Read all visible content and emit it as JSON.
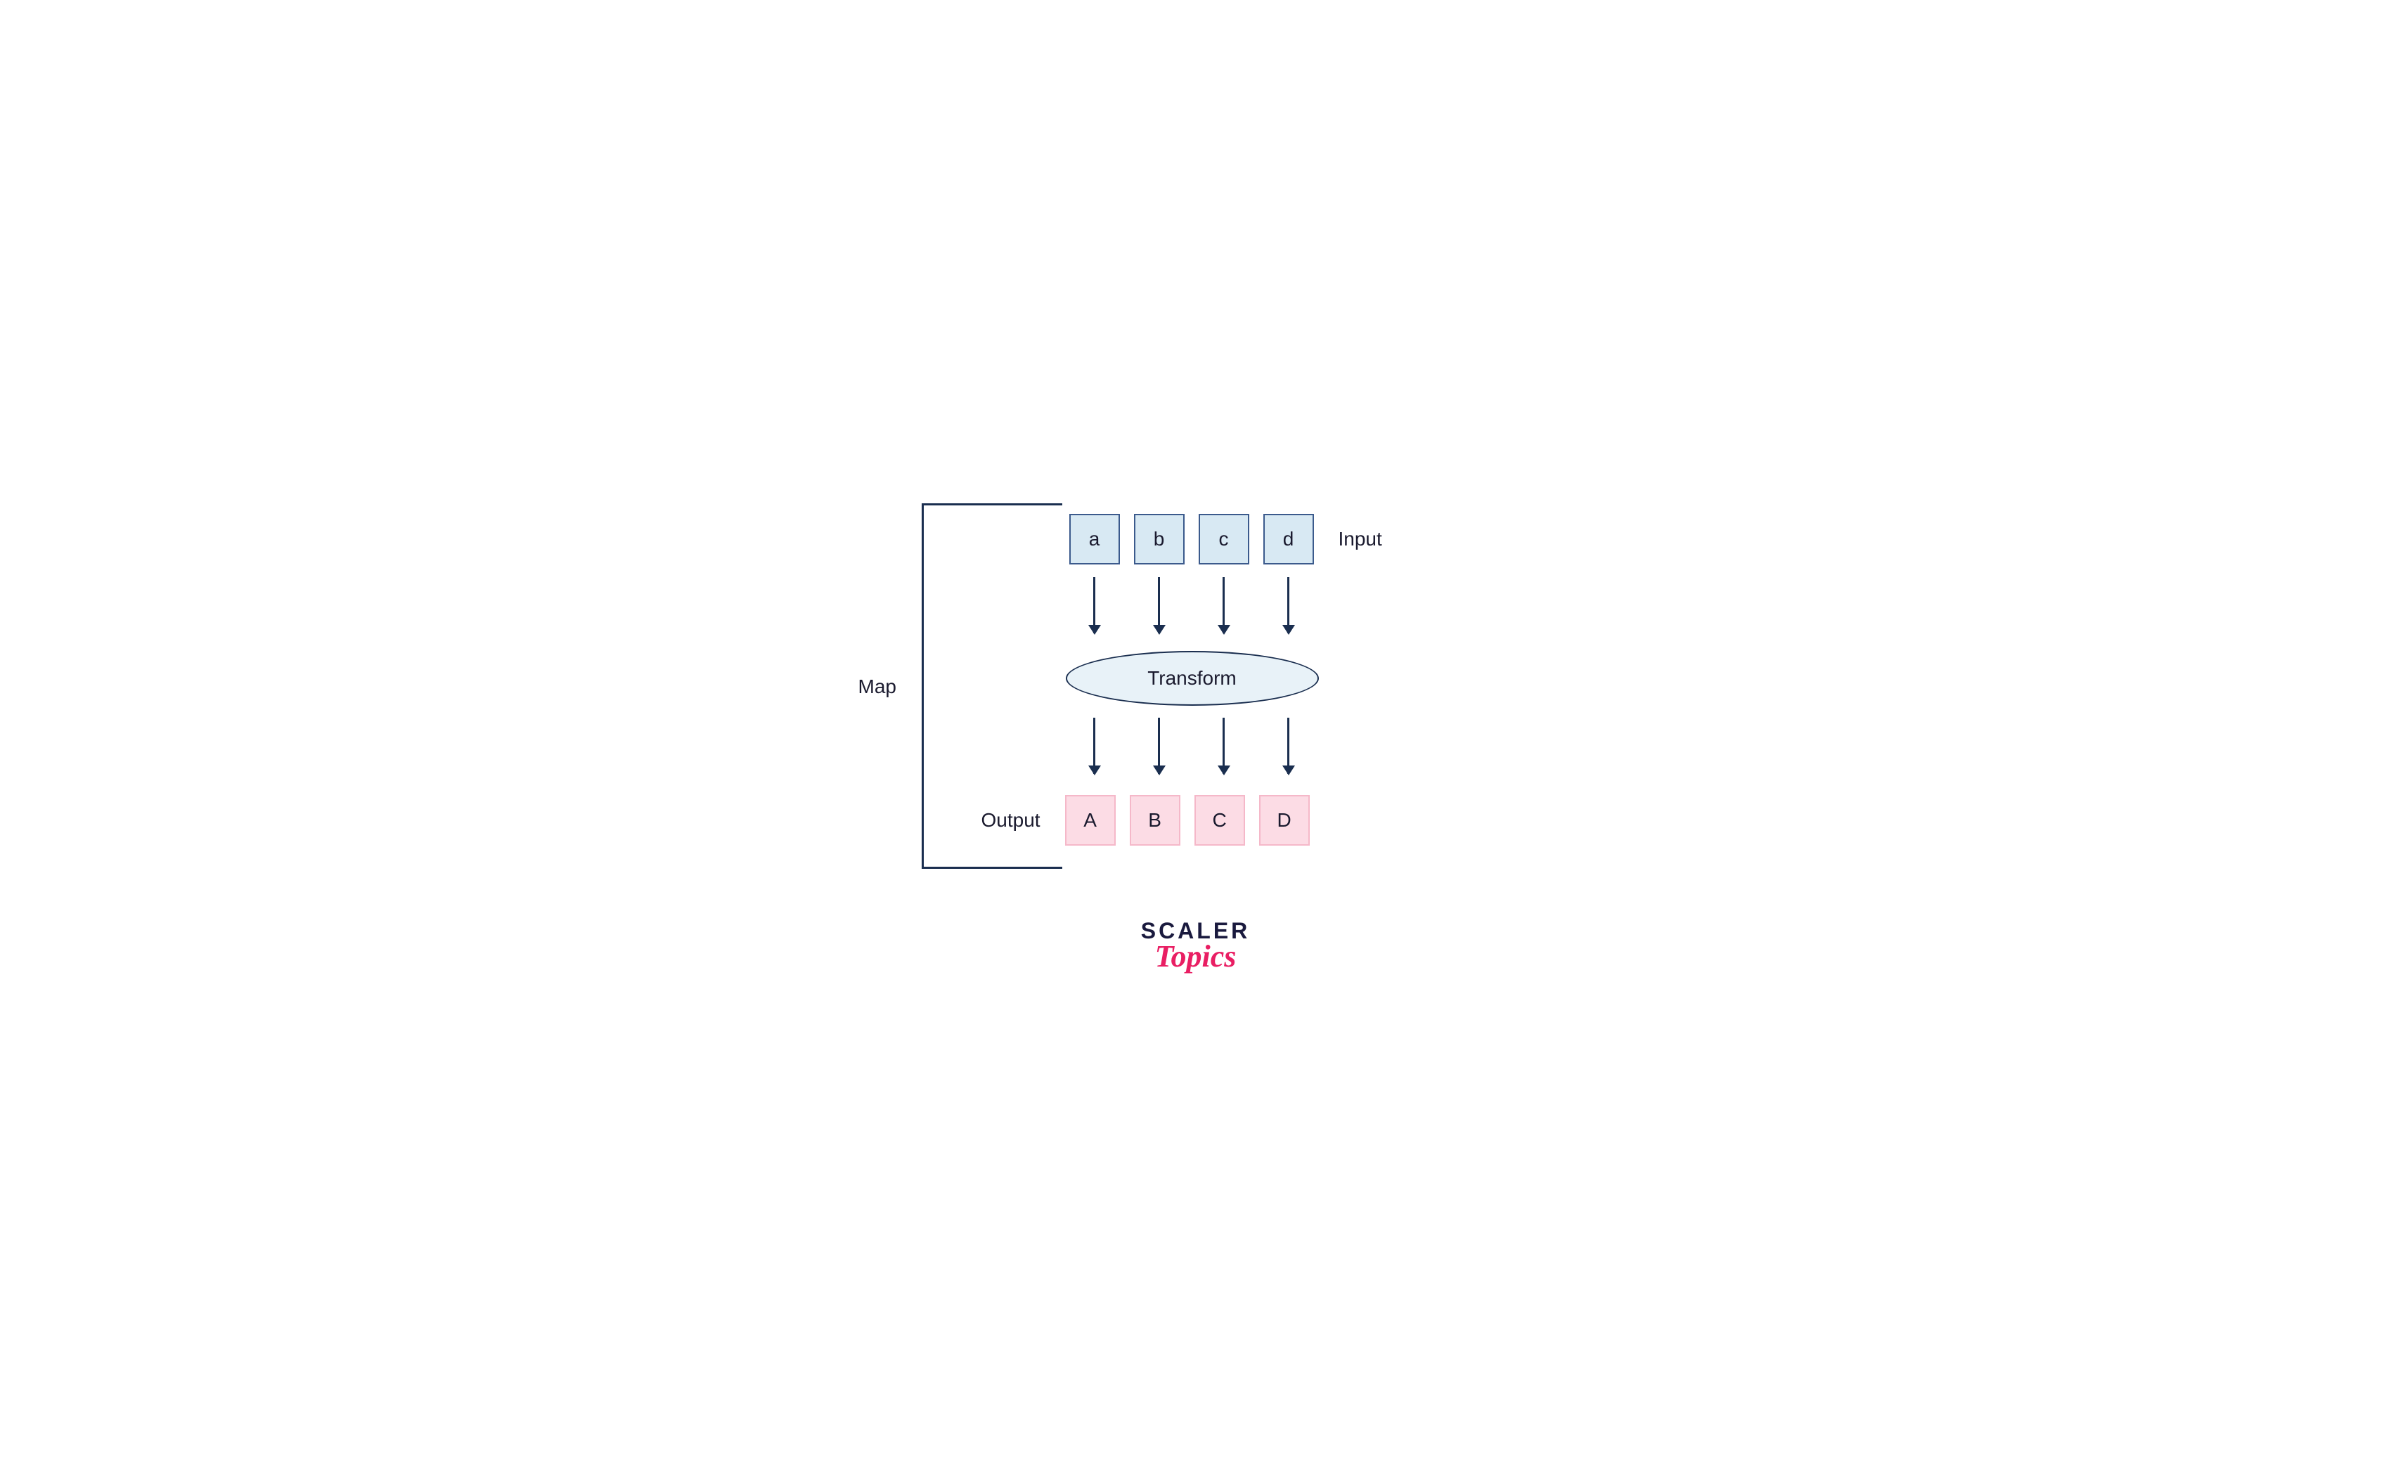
{
  "labels": {
    "map": "Map",
    "input": "Input",
    "output": "Output",
    "transform": "Transform"
  },
  "input_items": [
    "a",
    "b",
    "c",
    "d"
  ],
  "output_items": [
    "A",
    "B",
    "C",
    "D"
  ],
  "logo": {
    "line1": "SCALER",
    "line2": "Topics"
  },
  "colors": {
    "dark_navy": "#1a2e4f",
    "light_blue": "#d8e9f3",
    "blue_border": "#3b5a8c",
    "light_pink": "#fcdce5",
    "pink_border": "#f5b8c9",
    "magenta": "#e91e63"
  }
}
